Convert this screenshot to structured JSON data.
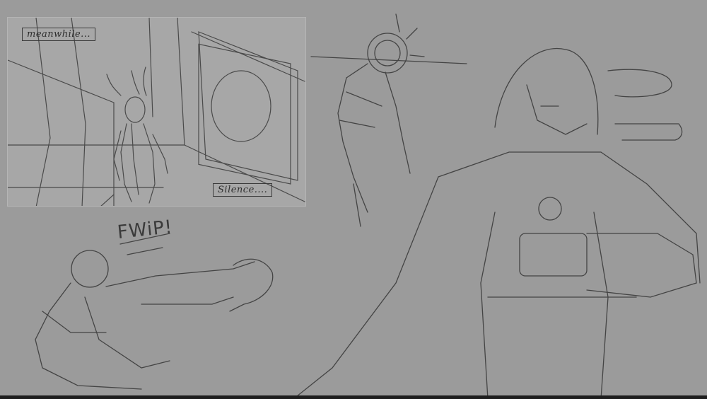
{
  "panel": {
    "caption_top": "meanwhile...",
    "caption_bottom": "Silence...."
  },
  "sfx": {
    "text": "FWiP!"
  },
  "colors": {
    "background": "#9b9b9b",
    "panel": "#a7a7a7",
    "ink": "#3a3a3a"
  }
}
